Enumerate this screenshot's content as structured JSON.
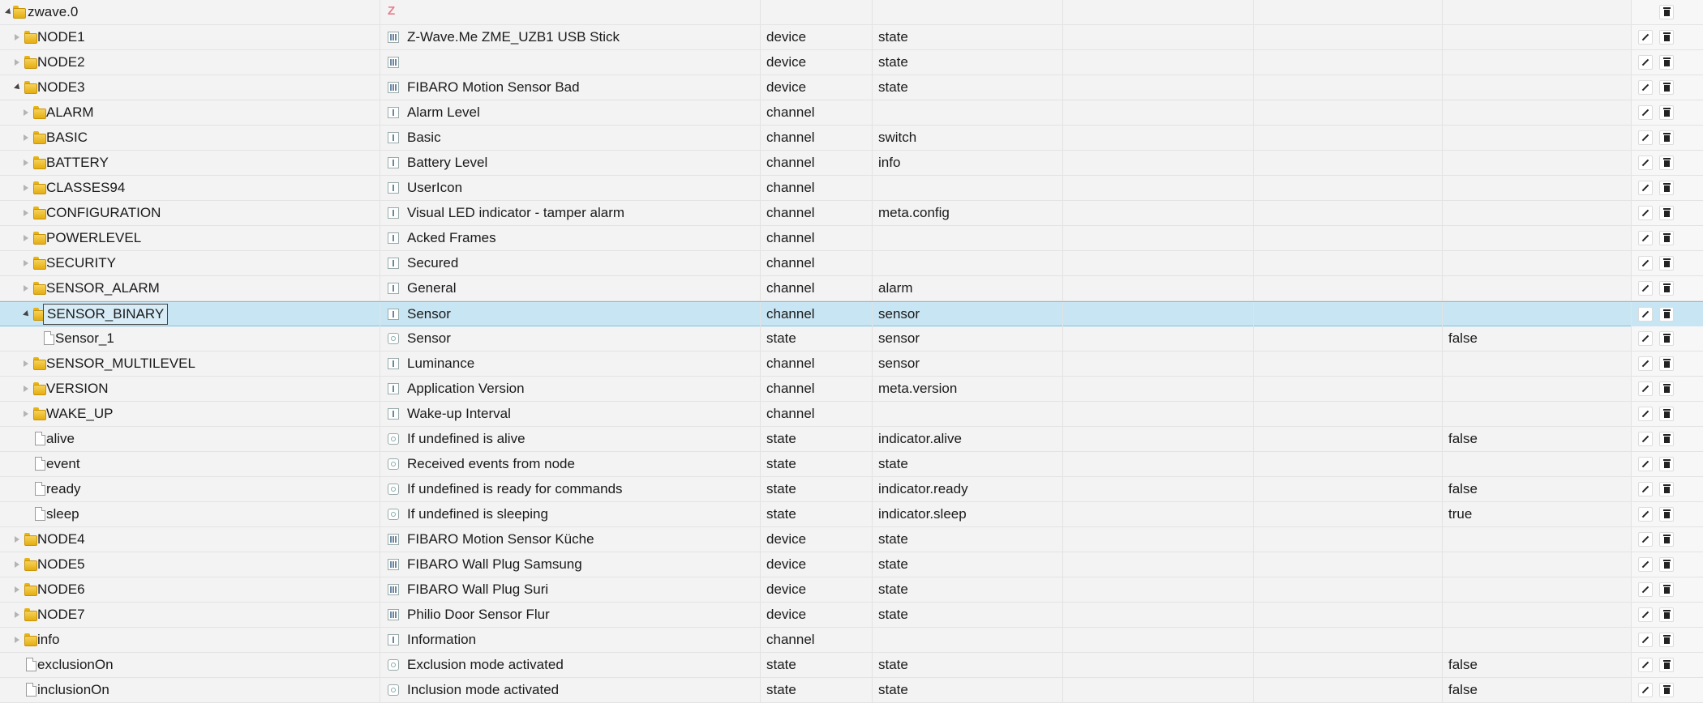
{
  "rows": [
    {
      "id": "zwave.0",
      "depth": 0,
      "kind": "folder",
      "toggle": "open",
      "name": "",
      "name_icon": "logo",
      "type": "",
      "role": "",
      "value": "",
      "actions": "del-only"
    },
    {
      "id": "NODE1",
      "depth": 1,
      "kind": "folder",
      "toggle": "closed",
      "name": "Z-Wave.Me ZME_UZB1 USB Stick",
      "name_icon": "device",
      "type": "device",
      "role": "state",
      "value": ""
    },
    {
      "id": "NODE2",
      "depth": 1,
      "kind": "folder",
      "toggle": "closed",
      "name": "",
      "name_icon": "device",
      "type": "device",
      "role": "state",
      "value": ""
    },
    {
      "id": "NODE3",
      "depth": 1,
      "kind": "folder",
      "toggle": "open",
      "name": "FIBARO Motion Sensor Bad",
      "name_icon": "device",
      "type": "device",
      "role": "state",
      "value": ""
    },
    {
      "id": "ALARM",
      "depth": 2,
      "kind": "folder",
      "toggle": "closed",
      "name": "Alarm Level",
      "name_icon": "channel",
      "type": "channel",
      "role": "",
      "value": ""
    },
    {
      "id": "BASIC",
      "depth": 2,
      "kind": "folder",
      "toggle": "closed",
      "name": "Basic",
      "name_icon": "channel",
      "type": "channel",
      "role": "switch",
      "value": ""
    },
    {
      "id": "BATTERY",
      "depth": 2,
      "kind": "folder",
      "toggle": "closed",
      "name": "Battery Level",
      "name_icon": "channel",
      "type": "channel",
      "role": "info",
      "value": ""
    },
    {
      "id": "CLASSES94",
      "depth": 2,
      "kind": "folder",
      "toggle": "closed",
      "name": "UserIcon",
      "name_icon": "channel",
      "type": "channel",
      "role": "",
      "value": ""
    },
    {
      "id": "CONFIGURATION",
      "depth": 2,
      "kind": "folder",
      "toggle": "closed",
      "name": "Visual LED indicator - tamper alarm",
      "name_icon": "channel",
      "type": "channel",
      "role": "meta.config",
      "value": ""
    },
    {
      "id": "POWERLEVEL",
      "depth": 2,
      "kind": "folder",
      "toggle": "closed",
      "name": "Acked Frames",
      "name_icon": "channel",
      "type": "channel",
      "role": "",
      "value": ""
    },
    {
      "id": "SECURITY",
      "depth": 2,
      "kind": "folder",
      "toggle": "closed",
      "name": "Secured",
      "name_icon": "channel",
      "type": "channel",
      "role": "",
      "value": ""
    },
    {
      "id": "SENSOR_ALARM",
      "depth": 2,
      "kind": "folder",
      "toggle": "closed",
      "name": "General",
      "name_icon": "channel",
      "type": "channel",
      "role": "alarm",
      "value": ""
    },
    {
      "id": "SENSOR_BINARY",
      "depth": 2,
      "kind": "folder",
      "toggle": "open",
      "name": "Sensor",
      "name_icon": "channel",
      "type": "channel",
      "role": "sensor",
      "value": "",
      "selected": true
    },
    {
      "id": "Sensor_1",
      "depth": 3,
      "kind": "file",
      "toggle": "",
      "name": "Sensor",
      "name_icon": "state",
      "type": "state",
      "role": "sensor",
      "value": "false"
    },
    {
      "id": "SENSOR_MULTILEVEL",
      "depth": 2,
      "kind": "folder",
      "toggle": "closed",
      "name": "Luminance",
      "name_icon": "channel",
      "type": "channel",
      "role": "sensor",
      "value": ""
    },
    {
      "id": "VERSION",
      "depth": 2,
      "kind": "folder",
      "toggle": "closed",
      "name": "Application Version",
      "name_icon": "channel",
      "type": "channel",
      "role": "meta.version",
      "value": ""
    },
    {
      "id": "WAKE_UP",
      "depth": 2,
      "kind": "folder",
      "toggle": "closed",
      "name": "Wake-up Interval",
      "name_icon": "channel",
      "type": "channel",
      "role": "",
      "value": ""
    },
    {
      "id": "alive",
      "depth": 2,
      "kind": "file",
      "toggle": "",
      "name": "If undefined is alive",
      "name_icon": "state",
      "type": "state",
      "role": "indicator.alive",
      "value": "false"
    },
    {
      "id": "event",
      "depth": 2,
      "kind": "file",
      "toggle": "",
      "name": "Received events from node",
      "name_icon": "state",
      "type": "state",
      "role": "state",
      "value": ""
    },
    {
      "id": "ready",
      "depth": 2,
      "kind": "file",
      "toggle": "",
      "name": "If undefined is ready for commands",
      "name_icon": "state",
      "type": "state",
      "role": "indicator.ready",
      "value": "false"
    },
    {
      "id": "sleep",
      "depth": 2,
      "kind": "file",
      "toggle": "",
      "name": "If undefined is sleeping",
      "name_icon": "state",
      "type": "state",
      "role": "indicator.sleep",
      "value": "true"
    },
    {
      "id": "NODE4",
      "depth": 1,
      "kind": "folder",
      "toggle": "closed",
      "name": "FIBARO Motion Sensor Küche",
      "name_icon": "device",
      "type": "device",
      "role": "state",
      "value": ""
    },
    {
      "id": "NODE5",
      "depth": 1,
      "kind": "folder",
      "toggle": "closed",
      "name": "FIBARO Wall Plug Samsung",
      "name_icon": "device",
      "type": "device",
      "role": "state",
      "value": ""
    },
    {
      "id": "NODE6",
      "depth": 1,
      "kind": "folder",
      "toggle": "closed",
      "name": "FIBARO Wall Plug Suri",
      "name_icon": "device",
      "type": "device",
      "role": "state",
      "value": ""
    },
    {
      "id": "NODE7",
      "depth": 1,
      "kind": "folder",
      "toggle": "closed",
      "name": "Philio Door Sensor Flur",
      "name_icon": "device",
      "type": "device",
      "role": "state",
      "value": ""
    },
    {
      "id": "info",
      "depth": 1,
      "kind": "folder",
      "toggle": "closed",
      "name": "Information",
      "name_icon": "channel",
      "type": "channel",
      "role": "",
      "value": ""
    },
    {
      "id": "exclusionOn",
      "depth": 1,
      "kind": "file",
      "toggle": "",
      "name": "Exclusion mode activated",
      "name_icon": "state",
      "type": "state",
      "role": "state",
      "value": "false"
    },
    {
      "id": "inclusionOn",
      "depth": 1,
      "kind": "file",
      "toggle": "",
      "name": "Inclusion mode activated",
      "name_icon": "state",
      "type": "state",
      "role": "state",
      "value": "false"
    }
  ],
  "icons": {
    "folder": "folder-icon",
    "file": "file-icon",
    "device": "device-icon",
    "channel": "channel-icon",
    "state": "state-icon",
    "logo": "zwave-logo-icon",
    "edit": "pencil-icon",
    "delete": "trash-icon"
  },
  "colors": {
    "selected_row": "#c8e5f3",
    "folder": "#f0c330",
    "logo": "#e67f8c"
  }
}
